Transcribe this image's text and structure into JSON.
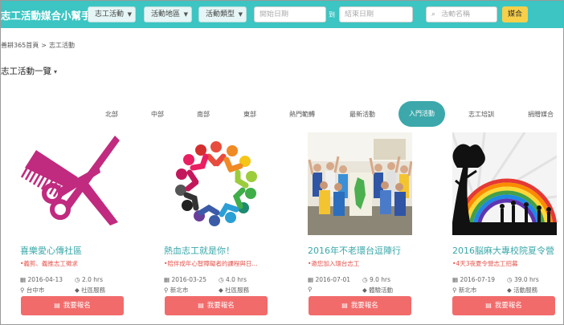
{
  "header": {
    "brand": "志工活動媒合小幫手",
    "dropdowns": [
      "志工活動",
      "活動地區",
      "活動類型"
    ],
    "start_date_placeholder": "開始日期",
    "to_label": "到",
    "end_date_placeholder": "結束日期",
    "search_placeholder": "活動名稱",
    "match_button": "媒合",
    "accent_color": "#3cc5c2",
    "button_color": "#f7cf49"
  },
  "breadcrumb": {
    "home": "善耕365首頁",
    "separator": ">",
    "current": "志工活動"
  },
  "page_title": "志工活動一覽",
  "tabs": [
    "北部",
    "中部",
    "南部",
    "東部",
    "熱門範轉",
    "最新活動",
    "入門活動",
    "志工培訓",
    "捐贈媒合"
  ],
  "active_tab": "入門活動",
  "cards": [
    {
      "title": "喜樂愛心傳社區",
      "subtitle": "•義剪、義推志工徵求",
      "date": "2016-04-13",
      "hours": "2.0 hrs",
      "location": "台中市",
      "category": "社區服務",
      "signup": "我要報名",
      "image": "scissors-comb-icon"
    },
    {
      "title": "熱血志工就是你！",
      "subtitle": "•陪伴成年心智障礙者的課程與日...",
      "date": "2016-03-25",
      "hours": "4.0 hrs",
      "location": "新北市",
      "category": "社區服務",
      "signup": "我要報名",
      "image": "people-circle-logo"
    },
    {
      "title": "2016年不老環台逗陣行",
      "subtitle": "•邀您加入環台志工",
      "date": "2016-07-01",
      "hours": "9.0 hrs",
      "location": "",
      "category": "體驗活動",
      "signup": "我要報名",
      "image": "group-photo"
    },
    {
      "title": "2016脳麻大專校院夏令營",
      "subtitle": "•4天3夜夏令營志工招募",
      "date": "2016-07-19",
      "hours": "39.0 hrs",
      "location": "新北市",
      "category": "活動服務",
      "signup": "我要報名",
      "image": "rainbow-silhouette"
    }
  ],
  "signup_color": "#f26b6b"
}
